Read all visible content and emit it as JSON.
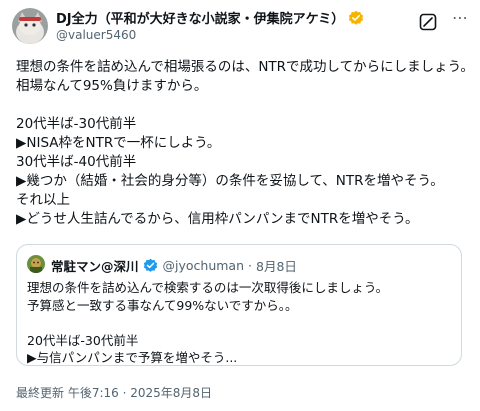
{
  "post": {
    "author_name": "DJ全力（平和が大好きな小説家・伊集院アケミ）",
    "author_handle": "@valuer5460",
    "body_lines": [
      "理想の条件を詰め込んで相場張るのは、NTRで成功してからにしましょう。",
      "相場なんて95%負けますから。",
      "",
      "20代半ば-30代前半",
      "▶NISA枠をNTRで一杯にしよう。",
      "30代半ば-40代前半",
      "▶幾つか（結婚・社会的身分等）の条件を妥協して、NTRを増やそう。",
      "それ以上",
      "▶どうせ人生詰んでるから、信用枠パンパンまでNTRを増やそう。"
    ],
    "timestamp": "最終更新 午後7:16 · 2025年8月8日",
    "icons": {
      "verified": "verified-badge-icon",
      "grok": "grok-icon",
      "more": "more-icon"
    },
    "accent_color": "#1d9bf0"
  },
  "quote": {
    "author_name": "常駐マン@深川",
    "author_handle": "@jyochuman",
    "separator": "·",
    "date": "8月8日",
    "body_lines": [
      "理想の条件を詰め込んで検索するのは一次取得後にしましょう。",
      "予算感と一致する事なんて99%ないですから。。",
      "",
      "20代半ば-30代前半",
      "▶与信パンパンまで予算を増やそう..."
    ]
  }
}
